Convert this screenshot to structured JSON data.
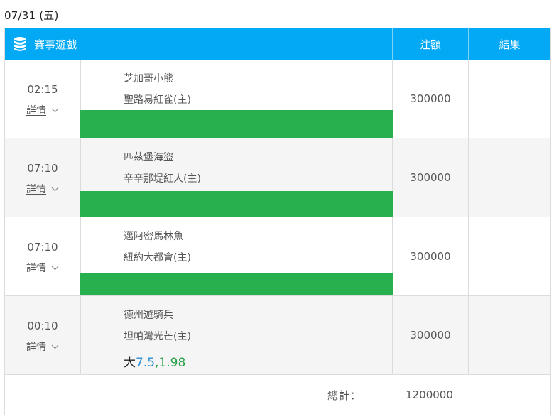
{
  "date_heading": "07/31 (五)",
  "header": {
    "icon": "database-icon",
    "game_label": "賽事遊戲",
    "stake_label": "注額",
    "result_label": "結果"
  },
  "rows": [
    {
      "time": "02:15",
      "details_label": "詳情",
      "away": "芝加哥小熊",
      "home": "聖路易紅雀(主)",
      "stake": "300000",
      "result": ""
    },
    {
      "time": "07:10",
      "details_label": "詳情",
      "away": "匹茲堡海盜",
      "home": "辛辛那堤紅人(主)",
      "stake": "300000",
      "result": ""
    },
    {
      "time": "07:10",
      "details_label": "詳情",
      "away": "邁阿密馬林魚",
      "home": "紐約大都會(主)",
      "stake": "300000",
      "result": ""
    },
    {
      "time": "00:10",
      "details_label": "詳情",
      "away": "德州遊騎兵",
      "home": "坦帕灣光芒(主)",
      "stake": "300000",
      "result": "",
      "pick": {
        "side": "大",
        "line": "7.5",
        "sep": ",",
        "odds": "1.98"
      }
    }
  ],
  "footer": {
    "total_label": "總計：",
    "total_value": "1200000"
  },
  "colors": {
    "header_bg": "#03a9f4",
    "highlight_bar": "#27b04d",
    "line_blue": "#2b8fd6",
    "odds_green": "#27a044"
  }
}
